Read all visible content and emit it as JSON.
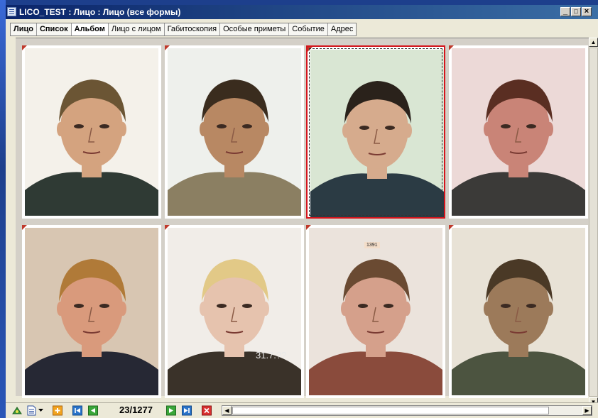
{
  "window": {
    "title": "LICO_TEST : Лицо : Лицо (все формы)"
  },
  "window_controls": {
    "minimize": "_",
    "maximize": "□",
    "close": "×"
  },
  "tabs": [
    {
      "label": "Лицо",
      "bold": true
    },
    {
      "label": "Список",
      "bold": true
    },
    {
      "label": "Альбом",
      "bold": true,
      "active": true
    },
    {
      "label": "Лицо с лицом"
    },
    {
      "label": "Габитоскопия"
    },
    {
      "label": "Особые приметы"
    },
    {
      "label": "Событие"
    },
    {
      "label": "Адрес"
    }
  ],
  "gallery": {
    "selected_index": 2,
    "photos": [
      {
        "bg": "#f4f1ea",
        "hair": "#6b5534",
        "skin": "#d4a37f",
        "shirt": "#2f3a34"
      },
      {
        "bg": "#eef0ec",
        "hair": "#3a2c1e",
        "skin": "#b88863",
        "shirt": "#8b7f62"
      },
      {
        "bg": "#d9e6d3",
        "hair": "#2a221b",
        "skin": "#d6ab8d",
        "shirt": "#2b3b44"
      },
      {
        "bg": "#ecd9d7",
        "hair": "#5a2e22",
        "skin": "#c98477",
        "shirt": "#3b3a38"
      },
      {
        "bg": "#d8c6b2",
        "hair": "#b07a38",
        "skin": "#d99a7c",
        "shirt": "#262834"
      },
      {
        "bg": "#f1ede8",
        "hair": "#e2c987",
        "skin": "#e6c3ae",
        "shirt": "#3a3229",
        "stamp": "31.7.??"
      },
      {
        "bg": "#ebe3dc",
        "hair": "#6a4a32",
        "skin": "#d5a08b",
        "shirt": "#8a4b3c",
        "tag": "1391"
      },
      {
        "bg": "#e8e2d6",
        "hair": "#4a3926",
        "skin": "#9c7a5a",
        "shirt": "#4c5440"
      }
    ]
  },
  "navigator": {
    "position": "23/1277"
  },
  "icons": [
    "export-icon",
    "document-icon",
    "dropdown-arrow-icon",
    "add-icon",
    "first-record-icon",
    "prev-record-icon",
    "next-record-icon",
    "last-record-icon",
    "delete-icon"
  ]
}
